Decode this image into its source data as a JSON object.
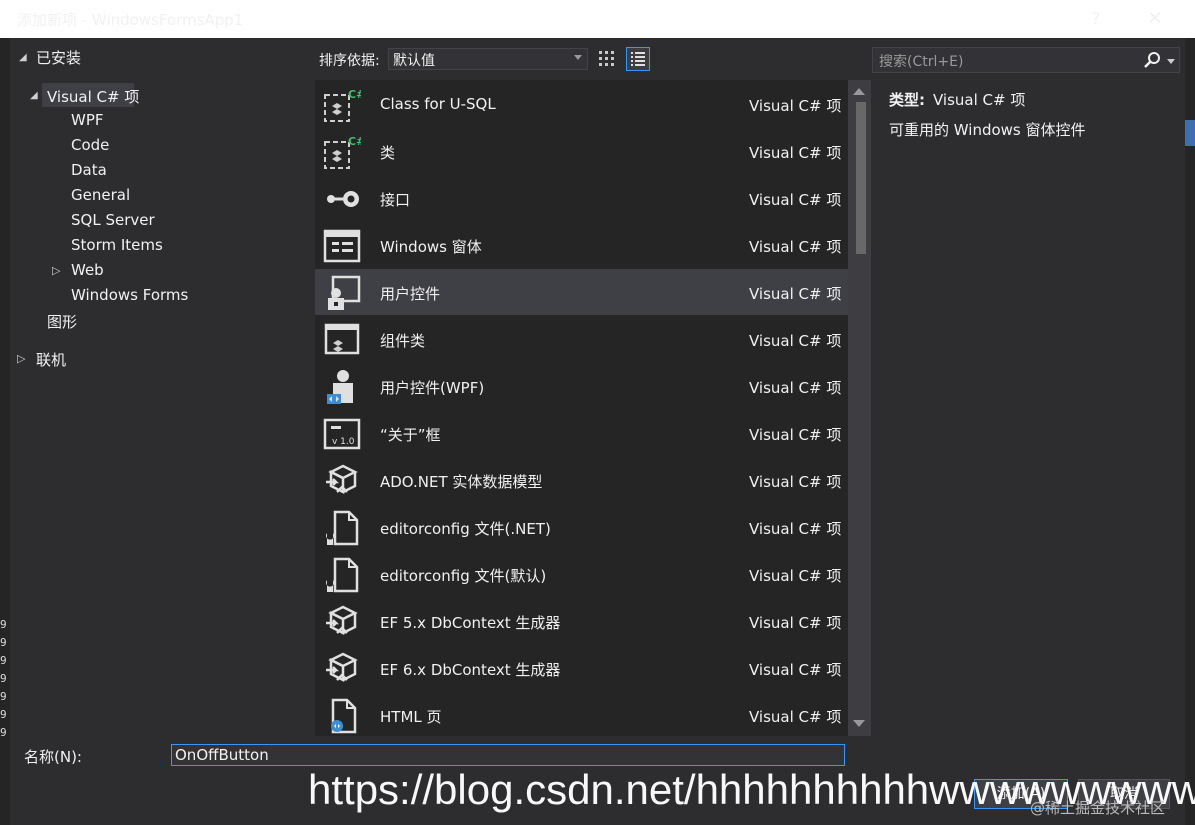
{
  "window": {
    "title": "添加新项 - WindowsFormsApp1",
    "help_label": "?",
    "close_label": "✕"
  },
  "tree": {
    "installed": "已安装",
    "visual_cs": "Visual C# 项",
    "children": [
      "WPF",
      "Code",
      "Data",
      "General",
      "SQL Server",
      "Storm Items",
      "Web",
      "Windows Forms"
    ],
    "graphics": "图形",
    "online": "联机"
  },
  "toolbar": {
    "sort_label": "排序依据:",
    "sort_value": "默认值",
    "search_placeholder": "搜索(Ctrl+E)"
  },
  "items": [
    {
      "name": "Class for U-SQL",
      "type": "Visual C# 项",
      "icon": "class-cs-icon"
    },
    {
      "name": "类",
      "type": "Visual C# 项",
      "icon": "class-cs-icon"
    },
    {
      "name": "接口",
      "type": "Visual C# 项",
      "icon": "interface-icon"
    },
    {
      "name": "Windows 窗体",
      "type": "Visual C# 项",
      "icon": "windows-form-icon"
    },
    {
      "name": "用户控件",
      "type": "Visual C# 项",
      "icon": "user-control-icon"
    },
    {
      "name": "组件类",
      "type": "Visual C# 项",
      "icon": "component-class-icon"
    },
    {
      "name": "用户控件(WPF)",
      "type": "Visual C# 项",
      "icon": "wpf-user-control-icon"
    },
    {
      "name": "“关于”框",
      "type": "Visual C# 项",
      "icon": "about-box-icon"
    },
    {
      "name": "ADO.NET 实体数据模型",
      "type": "Visual C# 项",
      "icon": "data-model-icon"
    },
    {
      "name": "editorconfig 文件(.NET)",
      "type": "Visual C# 项",
      "icon": "editorconfig-file-icon"
    },
    {
      "name": "editorconfig 文件(默认)",
      "type": "Visual C# 项",
      "icon": "editorconfig-file-icon"
    },
    {
      "name": "EF 5.x DbContext 生成器",
      "type": "Visual C# 项",
      "icon": "data-model-icon"
    },
    {
      "name": "EF 6.x DbContext 生成器",
      "type": "Visual C# 项",
      "icon": "data-model-icon"
    },
    {
      "name": "HTML 页",
      "type": "Visual C# 项",
      "icon": "html-page-icon"
    }
  ],
  "selected_index": 4,
  "details": {
    "type_label": "类型:",
    "type_value": "Visual C# 项",
    "description": "可重用的 Windows 窗体控件"
  },
  "bottom": {
    "name_label": "名称(N):",
    "name_value": "OnOffButton",
    "add_label": "添加(A)",
    "cancel_label": "取消"
  },
  "watermark": {
    "text": "https://blog.csdn.net/hhhhhhhhhhwwwwwwwwww",
    "small": "@稀土掘金技术社区"
  },
  "colors": {
    "background": "#2d2d30",
    "panel": "#252526",
    "selection": "#3f3f46",
    "accent": "#3399ff"
  }
}
